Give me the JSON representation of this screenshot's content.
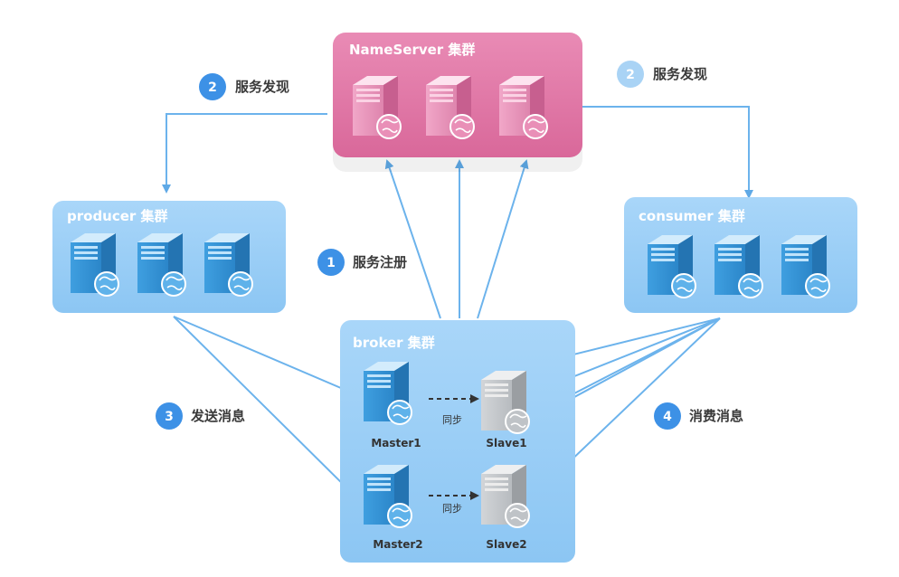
{
  "clusters": {
    "nameserver": "NameServer 集群",
    "producer": "producer 集群",
    "consumer": "consumer 集群",
    "broker": "broker 集群"
  },
  "steps": {
    "discover_left": {
      "num": "2",
      "text": "服务发现"
    },
    "discover_right": {
      "num": "2",
      "text": "服务发现"
    },
    "register": {
      "num": "1",
      "text": "服务注册"
    },
    "send": {
      "num": "3",
      "text": "发送消息"
    },
    "consume": {
      "num": "4",
      "text": "消费消息"
    }
  },
  "broker_nodes": {
    "master1": "Master1",
    "slave1": "Slave1",
    "master2": "Master2",
    "slave2": "Slave2",
    "sync": "同步"
  },
  "colors": {
    "pink_cluster": "#e07aa6",
    "blue_cluster": "#9fd0f7",
    "arrow": "#6cb3ec",
    "step_badge": "#3d91e6",
    "step_badge_light": "#a9d3f5"
  }
}
